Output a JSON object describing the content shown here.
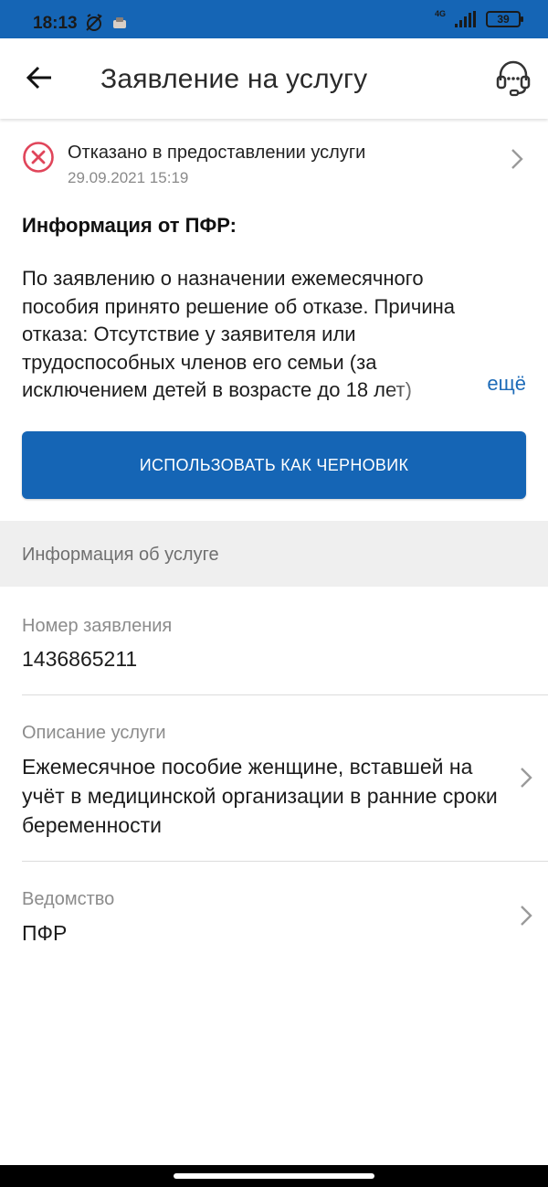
{
  "status_bar": {
    "time": "18:13",
    "battery": "39",
    "network": "4G"
  },
  "app_bar": {
    "title": "Заявление на услугу"
  },
  "status": {
    "label": "Отказано в предоставлении услуги",
    "date": "29.09.2021 15:19"
  },
  "info": {
    "heading": "Информация от ПФР:",
    "text": "По заявлению о назначении ежемесячного пособия принято решение об отказе. Причина отказа: Отсутствие у заявителя или трудоспособных членов его семьи (за исключением детей в возрасте до 18 лет)",
    "more_label": "ещё"
  },
  "draft_button": {
    "label": "ИСПОЛЬЗОВАТЬ КАК ЧЕРНОВИК"
  },
  "section": {
    "title": "Информация об услуге"
  },
  "fields": {
    "number": {
      "label": "Номер заявления",
      "value": "1436865211"
    },
    "description": {
      "label": "Описание услуги",
      "value": "Ежемесячное пособие женщине, вставшей на учёт в медицинской организации в ранние сроки беременности"
    },
    "agency": {
      "label": "Ведомство",
      "value": "ПФР"
    }
  },
  "colors": {
    "brand": "#1565b5",
    "error": "#e0455a",
    "link": "#1d6bb8"
  }
}
